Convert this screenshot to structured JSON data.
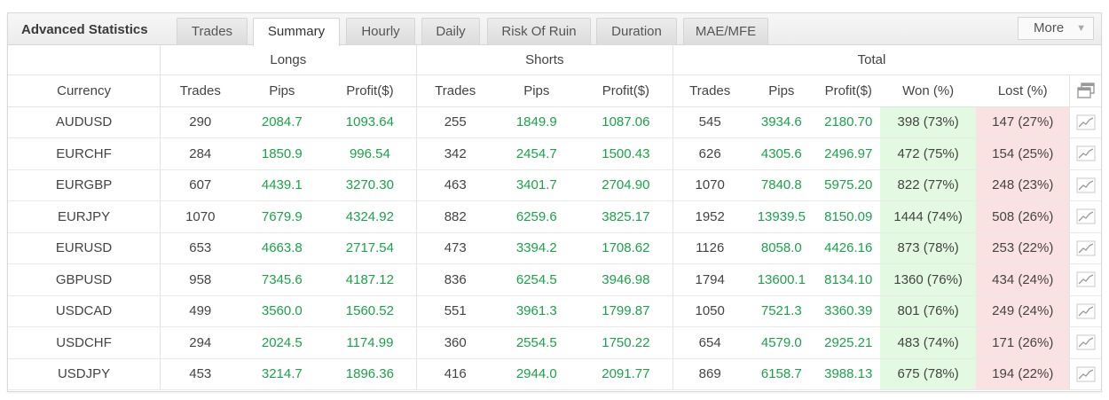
{
  "title": "Advanced Statistics",
  "tabs": [
    "Trades",
    "Summary",
    "Hourly",
    "Daily",
    "Risk Of Ruin",
    "Duration",
    "MAE/MFE"
  ],
  "active_tab": "Summary",
  "more_label": "More",
  "groups": {
    "longs": "Longs",
    "shorts": "Shorts",
    "total": "Total"
  },
  "columns": {
    "currency": "Currency",
    "trades": "Trades",
    "pips": "Pips",
    "profit": "Profit($)",
    "won": "Won (%)",
    "lost": "Lost (%)"
  },
  "rows": [
    [
      "AUDUSD",
      "290",
      "2084.7",
      "1093.64",
      "255",
      "1849.9",
      "1087.06",
      "545",
      "3934.6",
      "2180.70",
      "398 (73%)",
      "147 (27%)"
    ],
    [
      "EURCHF",
      "284",
      "1850.9",
      "996.54",
      "342",
      "2454.7",
      "1500.43",
      "626",
      "4305.6",
      "2496.97",
      "472 (75%)",
      "154 (25%)"
    ],
    [
      "EURGBP",
      "607",
      "4439.1",
      "3270.30",
      "463",
      "3401.7",
      "2704.90",
      "1070",
      "7840.8",
      "5975.20",
      "822 (77%)",
      "248 (23%)"
    ],
    [
      "EURJPY",
      "1070",
      "7679.9",
      "4324.92",
      "882",
      "6259.6",
      "3825.17",
      "1952",
      "13939.5",
      "8150.09",
      "1444 (74%)",
      "508 (26%)"
    ],
    [
      "EURUSD",
      "653",
      "4663.8",
      "2717.54",
      "473",
      "3394.2",
      "1708.62",
      "1126",
      "8058.0",
      "4426.16",
      "873 (78%)",
      "253 (22%)"
    ],
    [
      "GBPUSD",
      "958",
      "7345.6",
      "4187.12",
      "836",
      "6254.5",
      "3946.98",
      "1794",
      "13600.1",
      "8134.10",
      "1360 (76%)",
      "434 (24%)"
    ],
    [
      "USDCAD",
      "499",
      "3560.0",
      "1560.52",
      "551",
      "3961.3",
      "1799.87",
      "1050",
      "7521.3",
      "3360.39",
      "801 (76%)",
      "249 (24%)"
    ],
    [
      "USDCHF",
      "294",
      "2024.5",
      "1174.99",
      "360",
      "2554.5",
      "1750.22",
      "654",
      "4579.0",
      "2925.21",
      "483 (74%)",
      "171 (26%)"
    ],
    [
      "USDJPY",
      "453",
      "3214.7",
      "1896.36",
      "416",
      "2944.0",
      "2091.77",
      "869",
      "6158.7",
      "3988.13",
      "675 (78%)",
      "194 (22%)"
    ]
  ],
  "icons": {
    "table_toggle": "stacked-windows-icon",
    "row_chart": "line-chart-icon"
  },
  "colors": {
    "positive": "#1aa34a",
    "won_bg": "#e4f9e2",
    "lost_bg": "#fbe2e2"
  }
}
